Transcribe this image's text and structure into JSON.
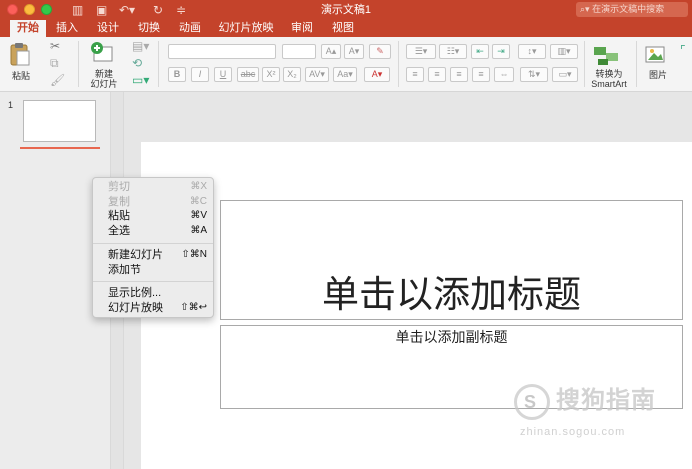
{
  "window": {
    "title": "演示文稿1",
    "search_placeholder": "在演示文稿中搜索"
  },
  "tabs": [
    {
      "label": "开始",
      "active": true
    },
    {
      "label": "插入",
      "active": false
    },
    {
      "label": "设计",
      "active": false
    },
    {
      "label": "切换",
      "active": false
    },
    {
      "label": "动画",
      "active": false
    },
    {
      "label": "幻灯片放映",
      "active": false
    },
    {
      "label": "审阅",
      "active": false
    },
    {
      "label": "视图",
      "active": false
    }
  ],
  "ribbon": {
    "paste_label": "粘贴",
    "new_slide_label_1": "新建",
    "new_slide_label_2": "幻灯片",
    "format_buttons": [
      "B",
      "I",
      "U",
      "abc",
      "X²",
      "X₂"
    ],
    "font_size_buttons": [
      "A▴",
      "A▾"
    ],
    "convert_label_1": "转换为",
    "convert_label_2": "SmartArt",
    "picture_label": "图片"
  },
  "slides_panel": {
    "slide_number": "1"
  },
  "slide": {
    "title_placeholder": "单击以添加标题",
    "subtitle_placeholder": "单击以添加副标题"
  },
  "context_menu": {
    "items": [
      {
        "label": "剪切",
        "shortcut": "⌘X",
        "enabled": false
      },
      {
        "label": "复制",
        "shortcut": "⌘C",
        "enabled": false
      },
      {
        "label": "粘贴",
        "shortcut": "⌘V",
        "enabled": true
      },
      {
        "label": "全选",
        "shortcut": "⌘A",
        "enabled": true
      },
      {
        "label": "新建幻灯片",
        "shortcut": "⇧⌘N",
        "enabled": true
      },
      {
        "label": "添加节",
        "shortcut": "",
        "enabled": true
      },
      {
        "label": "显示比例...",
        "shortcut": "",
        "enabled": true
      },
      {
        "label": "幻灯片放映",
        "shortcut": "⇧⌘↩",
        "enabled": true
      }
    ]
  },
  "watermark": {
    "logo_char": "S",
    "text": "搜狗指南",
    "url": "zhinan.sogou.com"
  },
  "colors": {
    "accent": "#c4432b",
    "ribbon_bg": "#f4f4f4",
    "thumb_highlight": "#e8674f"
  }
}
